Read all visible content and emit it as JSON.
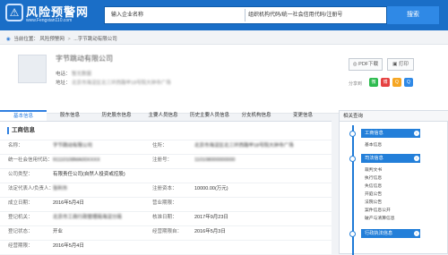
{
  "header": {
    "logo_title": "风险预警网",
    "logo_url": "www.Fengxian110.com",
    "search_name_placeholder": "输入企业名称",
    "search_code_placeholder": "组织机构代码/统一社会信用代码/注册号",
    "search_button": "搜索"
  },
  "breadcrumb": {
    "location_label": "当前位置：",
    "home": "风险预警网",
    "separator": ">",
    "current": "...字节跳动有限公司"
  },
  "company": {
    "name": "字节跳动有限公司",
    "phone_label": "电话：",
    "phone_value": "暂无数据",
    "address_label": "地址：",
    "address_value": "北京市海淀区北三环西路甲18号院大钟寺广场"
  },
  "actions": {
    "pdf_download": "PDF下载",
    "print": "打印",
    "share_label": "分享到"
  },
  "tabs": [
    {
      "label": "基本信息"
    },
    {
      "label": "股东信息"
    },
    {
      "label": "历史股东信息"
    },
    {
      "label": "主要人员信息"
    },
    {
      "label": "历史主要人员信息"
    },
    {
      "label": "分支机构信息"
    },
    {
      "label": "变更信息"
    }
  ],
  "business_info": {
    "section_title": "工商信息",
    "rows": [
      {
        "label": "名称：",
        "value": "字节跳动有限公司",
        "label2": "住所：",
        "value2": "北京市海淀区北三环西路甲18号院大钟寺广场"
      },
      {
        "label": "统一社会信用代码：",
        "value": "91110108MA00XXXX",
        "label2": "注册号：",
        "value2": "110108000000000"
      },
      {
        "label": "公司类型：",
        "value": "有限责任公司(自然人投资或控股)",
        "label2": "",
        "value2": ""
      },
      {
        "label": "法定代表人/负责人：",
        "value": "张利东",
        "label2": "注册资本：",
        "value2": "10000.00(万元)"
      },
      {
        "label": "成立日期：",
        "value": "2016年5月4日",
        "label2": "营业期限：",
        "value2": ""
      },
      {
        "label": "登记机关：",
        "value": "北京市工商行政管理局海淀分局",
        "label2": "核准日期：",
        "value2": "2017年9月23日"
      },
      {
        "label": "登记状态：",
        "value": "开业",
        "label2": "经营期限自：",
        "value2": "2016年5月3日"
      },
      {
        "label": "经营期限：",
        "value": "2016年5月4日",
        "label2": "",
        "value2": ""
      }
    ]
  },
  "sidebar": {
    "title": "相关查询",
    "groups": [
      {
        "title": "工商信息",
        "items": [
          "基本信息"
        ]
      },
      {
        "title": "司法信息",
        "items": [
          "裁判文书",
          "执行信息",
          "失信信息",
          "开庭公告",
          "法院公告",
          "案件信息公开",
          "破产与清算信息"
        ]
      },
      {
        "title": "行政执法信息",
        "items": []
      }
    ]
  },
  "theme": {
    "header_blue": "#1a6ec7",
    "accent_blue": "#2f7fe0",
    "search_blue": "#2f89e6"
  }
}
